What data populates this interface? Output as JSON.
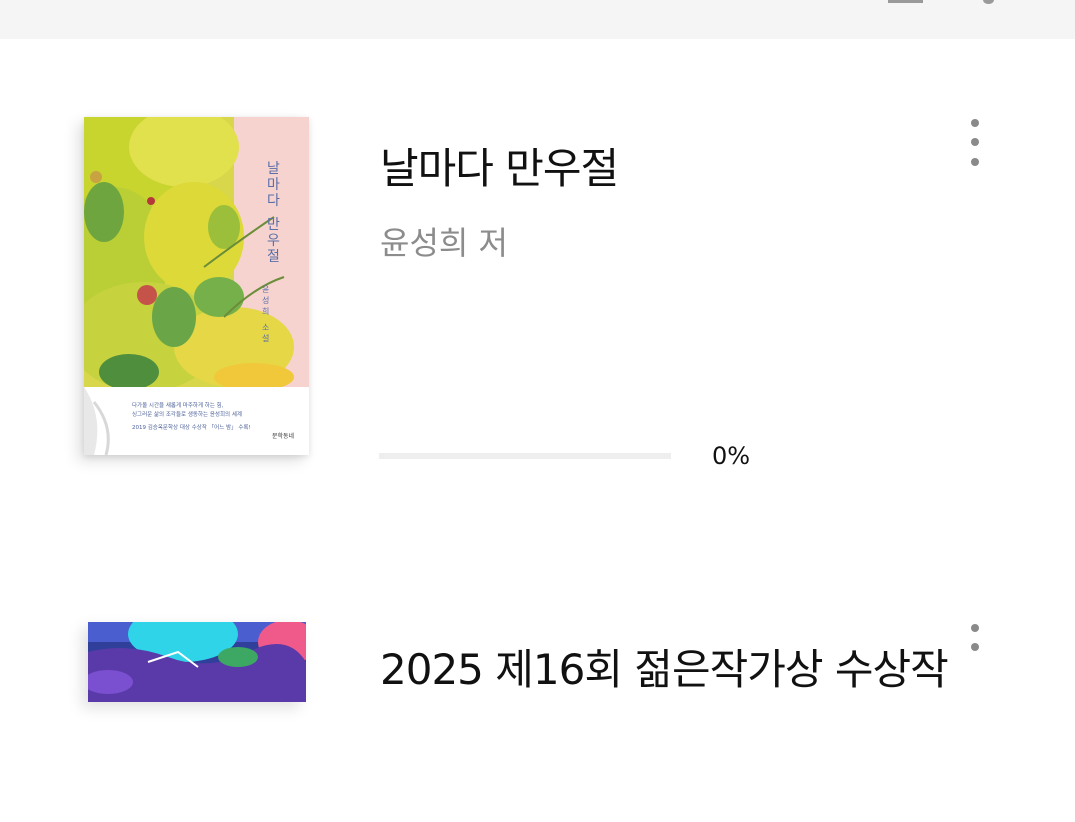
{
  "books": [
    {
      "title": "날마다 만우절",
      "author": "윤성희 저",
      "progress_percent": 0,
      "progress_label": "0%",
      "cover": {
        "vertical_title": "날마다 만우절",
        "vertical_author": "윤성희 소설",
        "blurb_line1": "다가올 시간을 새롭게 마주하게 하는 힘,",
        "blurb_line2": "싱그러운 삶의 조각들로 생동하는 윤성희의 세계",
        "award_line": "2019 김승옥문학상 대상 수상작 「어느 밤」 수록!",
        "publisher": "문학동네"
      }
    },
    {
      "title": "2025 제16회 젊은작가상 수상작"
    }
  ],
  "colors": {
    "topbar_bg": "#f5f5f5",
    "title": "#111111",
    "author": "#8c8c8c",
    "progress_track": "#eeeeee",
    "menu_dots": "#8a8a8a"
  }
}
